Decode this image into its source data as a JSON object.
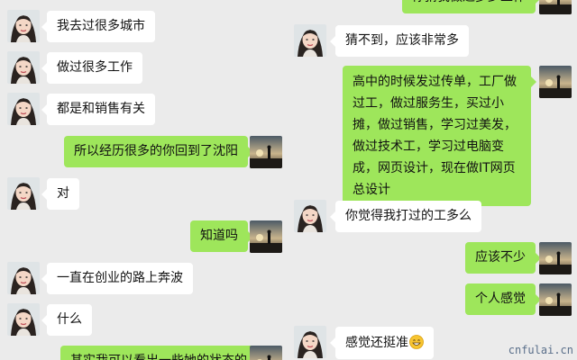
{
  "left_chat": {
    "messages": [
      {
        "side": "in",
        "text": "我去过很多城市"
      },
      {
        "side": "in",
        "text": "做过很多工作"
      },
      {
        "side": "in",
        "text": "都是和销售有关"
      },
      {
        "side": "out",
        "text": "所以经历很多的你回到了沈阳"
      },
      {
        "side": "in",
        "text": "对"
      },
      {
        "side": "out",
        "text": "知道吗"
      },
      {
        "side": "in",
        "text": "一直在创业的路上奔波"
      },
      {
        "side": "in",
        "text": "什么"
      },
      {
        "side": "out",
        "text": "其实我可以看出一些她的状态的"
      }
    ]
  },
  "right_chat": {
    "messages": [
      {
        "side": "out",
        "text": "你猜我做过多少工作"
      },
      {
        "side": "in",
        "text": "猜不到，应该非常多"
      },
      {
        "side": "out",
        "text": "高中的时候发过传单，工厂做过工，做过服务生，买过小摊，做过销售，学习过美发，做过技术工，学习过电脑变成，网页设计，现在做IT网页总设计"
      },
      {
        "side": "in",
        "text": "你觉得我打过的工多么"
      },
      {
        "side": "out",
        "text": "应该不少"
      },
      {
        "side": "out",
        "text": "个人感觉"
      },
      {
        "side": "in",
        "text": "感觉还挺准",
        "emoji": "grinning-face-emoji"
      }
    ]
  },
  "watermark": "cnfulai.cn",
  "colors": {
    "background": "#ebebeb",
    "incoming_bubble": "#ffffff",
    "outgoing_bubble": "#9ee65b"
  },
  "icons": {
    "contact_avatar": "woman-portrait-avatar-icon",
    "self_avatar": "sunset-silhouette-avatar-icon"
  }
}
